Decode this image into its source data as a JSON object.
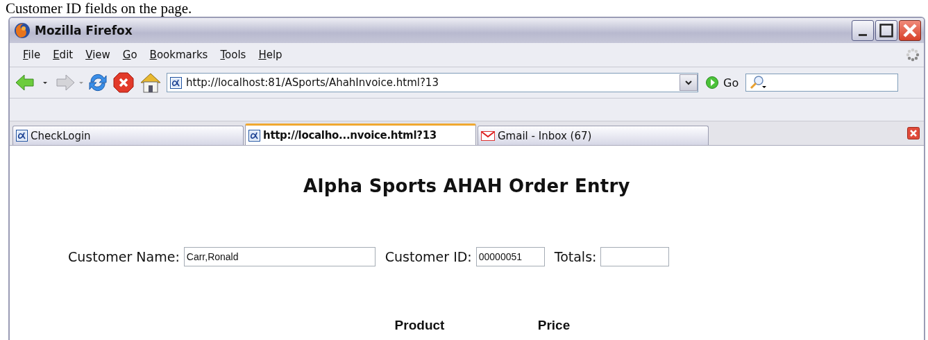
{
  "caption": "Customer ID fields on the page.",
  "window": {
    "title": "Mozilla Firefox"
  },
  "menu": [
    "File",
    "Edit",
    "View",
    "Go",
    "Bookmarks",
    "Tools",
    "Help"
  ],
  "address": {
    "value": "http://localhost:81/ASports/AhahInvoice.html?13",
    "go_label": "Go"
  },
  "tabs": [
    {
      "label": "CheckLogin",
      "selected": false,
      "kind": "alpha"
    },
    {
      "label": "http://localho...nvoice.html?13",
      "selected": true,
      "kind": "alpha"
    },
    {
      "label": "Gmail - Inbox (67)",
      "selected": false,
      "kind": "gmail"
    }
  ],
  "page": {
    "heading": "Alpha Sports AHAH Order Entry",
    "fields": [
      {
        "label": "Customer Name:",
        "value": "Carr,Ronald"
      },
      {
        "label": "Customer ID:",
        "value": "00000051"
      },
      {
        "label": "Totals:"
      }
    ],
    "table": {
      "columns": [
        "Product",
        "Price"
      ]
    }
  }
}
